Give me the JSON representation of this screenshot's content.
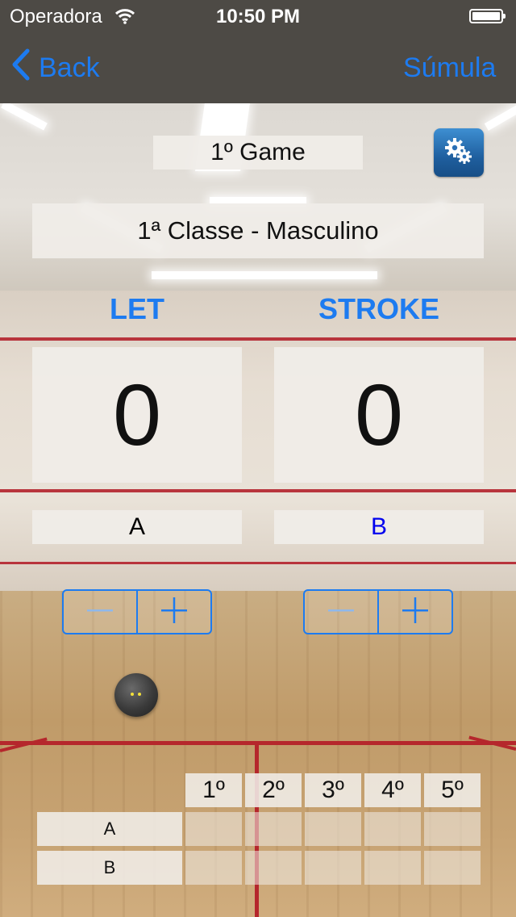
{
  "status_bar": {
    "carrier": "Operadora",
    "time": "10:50 PM"
  },
  "nav": {
    "back_label": "Back",
    "right_label": "Súmula"
  },
  "game_title": "1º Game",
  "category": "1ª Classe - Masculino",
  "columns": [
    {
      "heading": "LET",
      "score": "0",
      "player": "A",
      "player_color": "#000000"
    },
    {
      "heading": "STROKE",
      "score": "0",
      "player": "B",
      "player_color": "#0000ee"
    }
  ],
  "table": {
    "games": [
      "1º",
      "2º",
      "3º",
      "4º",
      "5º"
    ],
    "rows": [
      {
        "label": "A",
        "values": [
          "",
          "",
          "",
          "",
          ""
        ]
      },
      {
        "label": "B",
        "values": [
          "",
          "",
          "",
          "",
          ""
        ]
      }
    ]
  },
  "colors": {
    "accent": "#1d7bf0",
    "nav_bg": "#4d4a45",
    "settings_button": "#2a6fb5"
  },
  "icons": {
    "back": "chevron-left-icon",
    "settings": "gears-icon",
    "decrement": "minus-icon",
    "increment": "plus-icon",
    "wifi": "wifi-icon",
    "battery": "battery-icon"
  }
}
